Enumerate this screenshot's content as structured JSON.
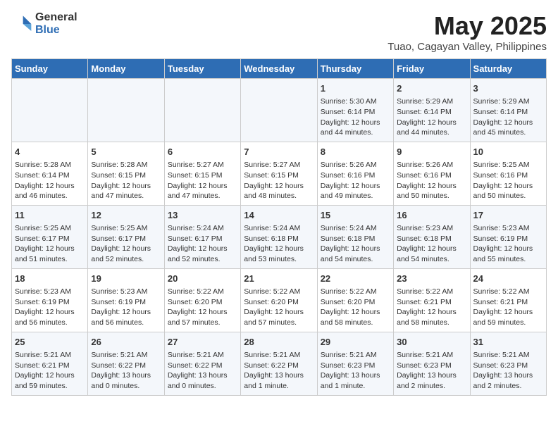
{
  "header": {
    "logo_general": "General",
    "logo_blue": "Blue",
    "title": "May 2025",
    "subtitle": "Tuao, Cagayan Valley, Philippines"
  },
  "columns": [
    "Sunday",
    "Monday",
    "Tuesday",
    "Wednesday",
    "Thursday",
    "Friday",
    "Saturday"
  ],
  "weeks": [
    {
      "days": [
        {
          "number": "",
          "info": ""
        },
        {
          "number": "",
          "info": ""
        },
        {
          "number": "",
          "info": ""
        },
        {
          "number": "",
          "info": ""
        },
        {
          "number": "1",
          "info": "Sunrise: 5:30 AM\nSunset: 6:14 PM\nDaylight: 12 hours\nand 44 minutes."
        },
        {
          "number": "2",
          "info": "Sunrise: 5:29 AM\nSunset: 6:14 PM\nDaylight: 12 hours\nand 44 minutes."
        },
        {
          "number": "3",
          "info": "Sunrise: 5:29 AM\nSunset: 6:14 PM\nDaylight: 12 hours\nand 45 minutes."
        }
      ]
    },
    {
      "days": [
        {
          "number": "4",
          "info": "Sunrise: 5:28 AM\nSunset: 6:14 PM\nDaylight: 12 hours\nand 46 minutes."
        },
        {
          "number": "5",
          "info": "Sunrise: 5:28 AM\nSunset: 6:15 PM\nDaylight: 12 hours\nand 47 minutes."
        },
        {
          "number": "6",
          "info": "Sunrise: 5:27 AM\nSunset: 6:15 PM\nDaylight: 12 hours\nand 47 minutes."
        },
        {
          "number": "7",
          "info": "Sunrise: 5:27 AM\nSunset: 6:15 PM\nDaylight: 12 hours\nand 48 minutes."
        },
        {
          "number": "8",
          "info": "Sunrise: 5:26 AM\nSunset: 6:16 PM\nDaylight: 12 hours\nand 49 minutes."
        },
        {
          "number": "9",
          "info": "Sunrise: 5:26 AM\nSunset: 6:16 PM\nDaylight: 12 hours\nand 50 minutes."
        },
        {
          "number": "10",
          "info": "Sunrise: 5:25 AM\nSunset: 6:16 PM\nDaylight: 12 hours\nand 50 minutes."
        }
      ]
    },
    {
      "days": [
        {
          "number": "11",
          "info": "Sunrise: 5:25 AM\nSunset: 6:17 PM\nDaylight: 12 hours\nand 51 minutes."
        },
        {
          "number": "12",
          "info": "Sunrise: 5:25 AM\nSunset: 6:17 PM\nDaylight: 12 hours\nand 52 minutes."
        },
        {
          "number": "13",
          "info": "Sunrise: 5:24 AM\nSunset: 6:17 PM\nDaylight: 12 hours\nand 52 minutes."
        },
        {
          "number": "14",
          "info": "Sunrise: 5:24 AM\nSunset: 6:18 PM\nDaylight: 12 hours\nand 53 minutes."
        },
        {
          "number": "15",
          "info": "Sunrise: 5:24 AM\nSunset: 6:18 PM\nDaylight: 12 hours\nand 54 minutes."
        },
        {
          "number": "16",
          "info": "Sunrise: 5:23 AM\nSunset: 6:18 PM\nDaylight: 12 hours\nand 54 minutes."
        },
        {
          "number": "17",
          "info": "Sunrise: 5:23 AM\nSunset: 6:19 PM\nDaylight: 12 hours\nand 55 minutes."
        }
      ]
    },
    {
      "days": [
        {
          "number": "18",
          "info": "Sunrise: 5:23 AM\nSunset: 6:19 PM\nDaylight: 12 hours\nand 56 minutes."
        },
        {
          "number": "19",
          "info": "Sunrise: 5:23 AM\nSunset: 6:19 PM\nDaylight: 12 hours\nand 56 minutes."
        },
        {
          "number": "20",
          "info": "Sunrise: 5:22 AM\nSunset: 6:20 PM\nDaylight: 12 hours\nand 57 minutes."
        },
        {
          "number": "21",
          "info": "Sunrise: 5:22 AM\nSunset: 6:20 PM\nDaylight: 12 hours\nand 57 minutes."
        },
        {
          "number": "22",
          "info": "Sunrise: 5:22 AM\nSunset: 6:20 PM\nDaylight: 12 hours\nand 58 minutes."
        },
        {
          "number": "23",
          "info": "Sunrise: 5:22 AM\nSunset: 6:21 PM\nDaylight: 12 hours\nand 58 minutes."
        },
        {
          "number": "24",
          "info": "Sunrise: 5:22 AM\nSunset: 6:21 PM\nDaylight: 12 hours\nand 59 minutes."
        }
      ]
    },
    {
      "days": [
        {
          "number": "25",
          "info": "Sunrise: 5:21 AM\nSunset: 6:21 PM\nDaylight: 12 hours\nand 59 minutes."
        },
        {
          "number": "26",
          "info": "Sunrise: 5:21 AM\nSunset: 6:22 PM\nDaylight: 13 hours\nand 0 minutes."
        },
        {
          "number": "27",
          "info": "Sunrise: 5:21 AM\nSunset: 6:22 PM\nDaylight: 13 hours\nand 0 minutes."
        },
        {
          "number": "28",
          "info": "Sunrise: 5:21 AM\nSunset: 6:22 PM\nDaylight: 13 hours\nand 1 minute."
        },
        {
          "number": "29",
          "info": "Sunrise: 5:21 AM\nSunset: 6:23 PM\nDaylight: 13 hours\nand 1 minute."
        },
        {
          "number": "30",
          "info": "Sunrise: 5:21 AM\nSunset: 6:23 PM\nDaylight: 13 hours\nand 2 minutes."
        },
        {
          "number": "31",
          "info": "Sunrise: 5:21 AM\nSunset: 6:23 PM\nDaylight: 13 hours\nand 2 minutes."
        }
      ]
    }
  ]
}
